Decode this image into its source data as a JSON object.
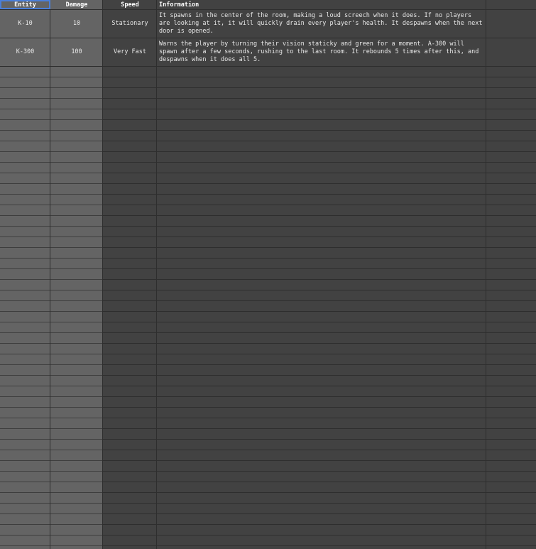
{
  "headers": {
    "entity": "Entity",
    "damage": "Damage",
    "speed": "Speed",
    "information": "Information"
  },
  "rows": [
    {
      "entity": "K-10",
      "damage": "10",
      "speed": "Stationary",
      "information": "It spawns in the center of the room, making a loud screech when it does. If no players are looking at it, it will quickly drain every player's health. It despawns when the next door is opened."
    },
    {
      "entity": "K-300",
      "damage": "100",
      "speed": "Very Fast",
      "information": "Warns the player by turning their vision staticky and green for a moment. A-300 will spawn after a few seconds, rushing to the last room. It rebounds 5 times after this, and despawns when it does all 5."
    }
  ],
  "colors": {
    "selection": "#4a7fd9",
    "frozen_column_bg": "#646464",
    "sheet_bg": "#424242"
  }
}
